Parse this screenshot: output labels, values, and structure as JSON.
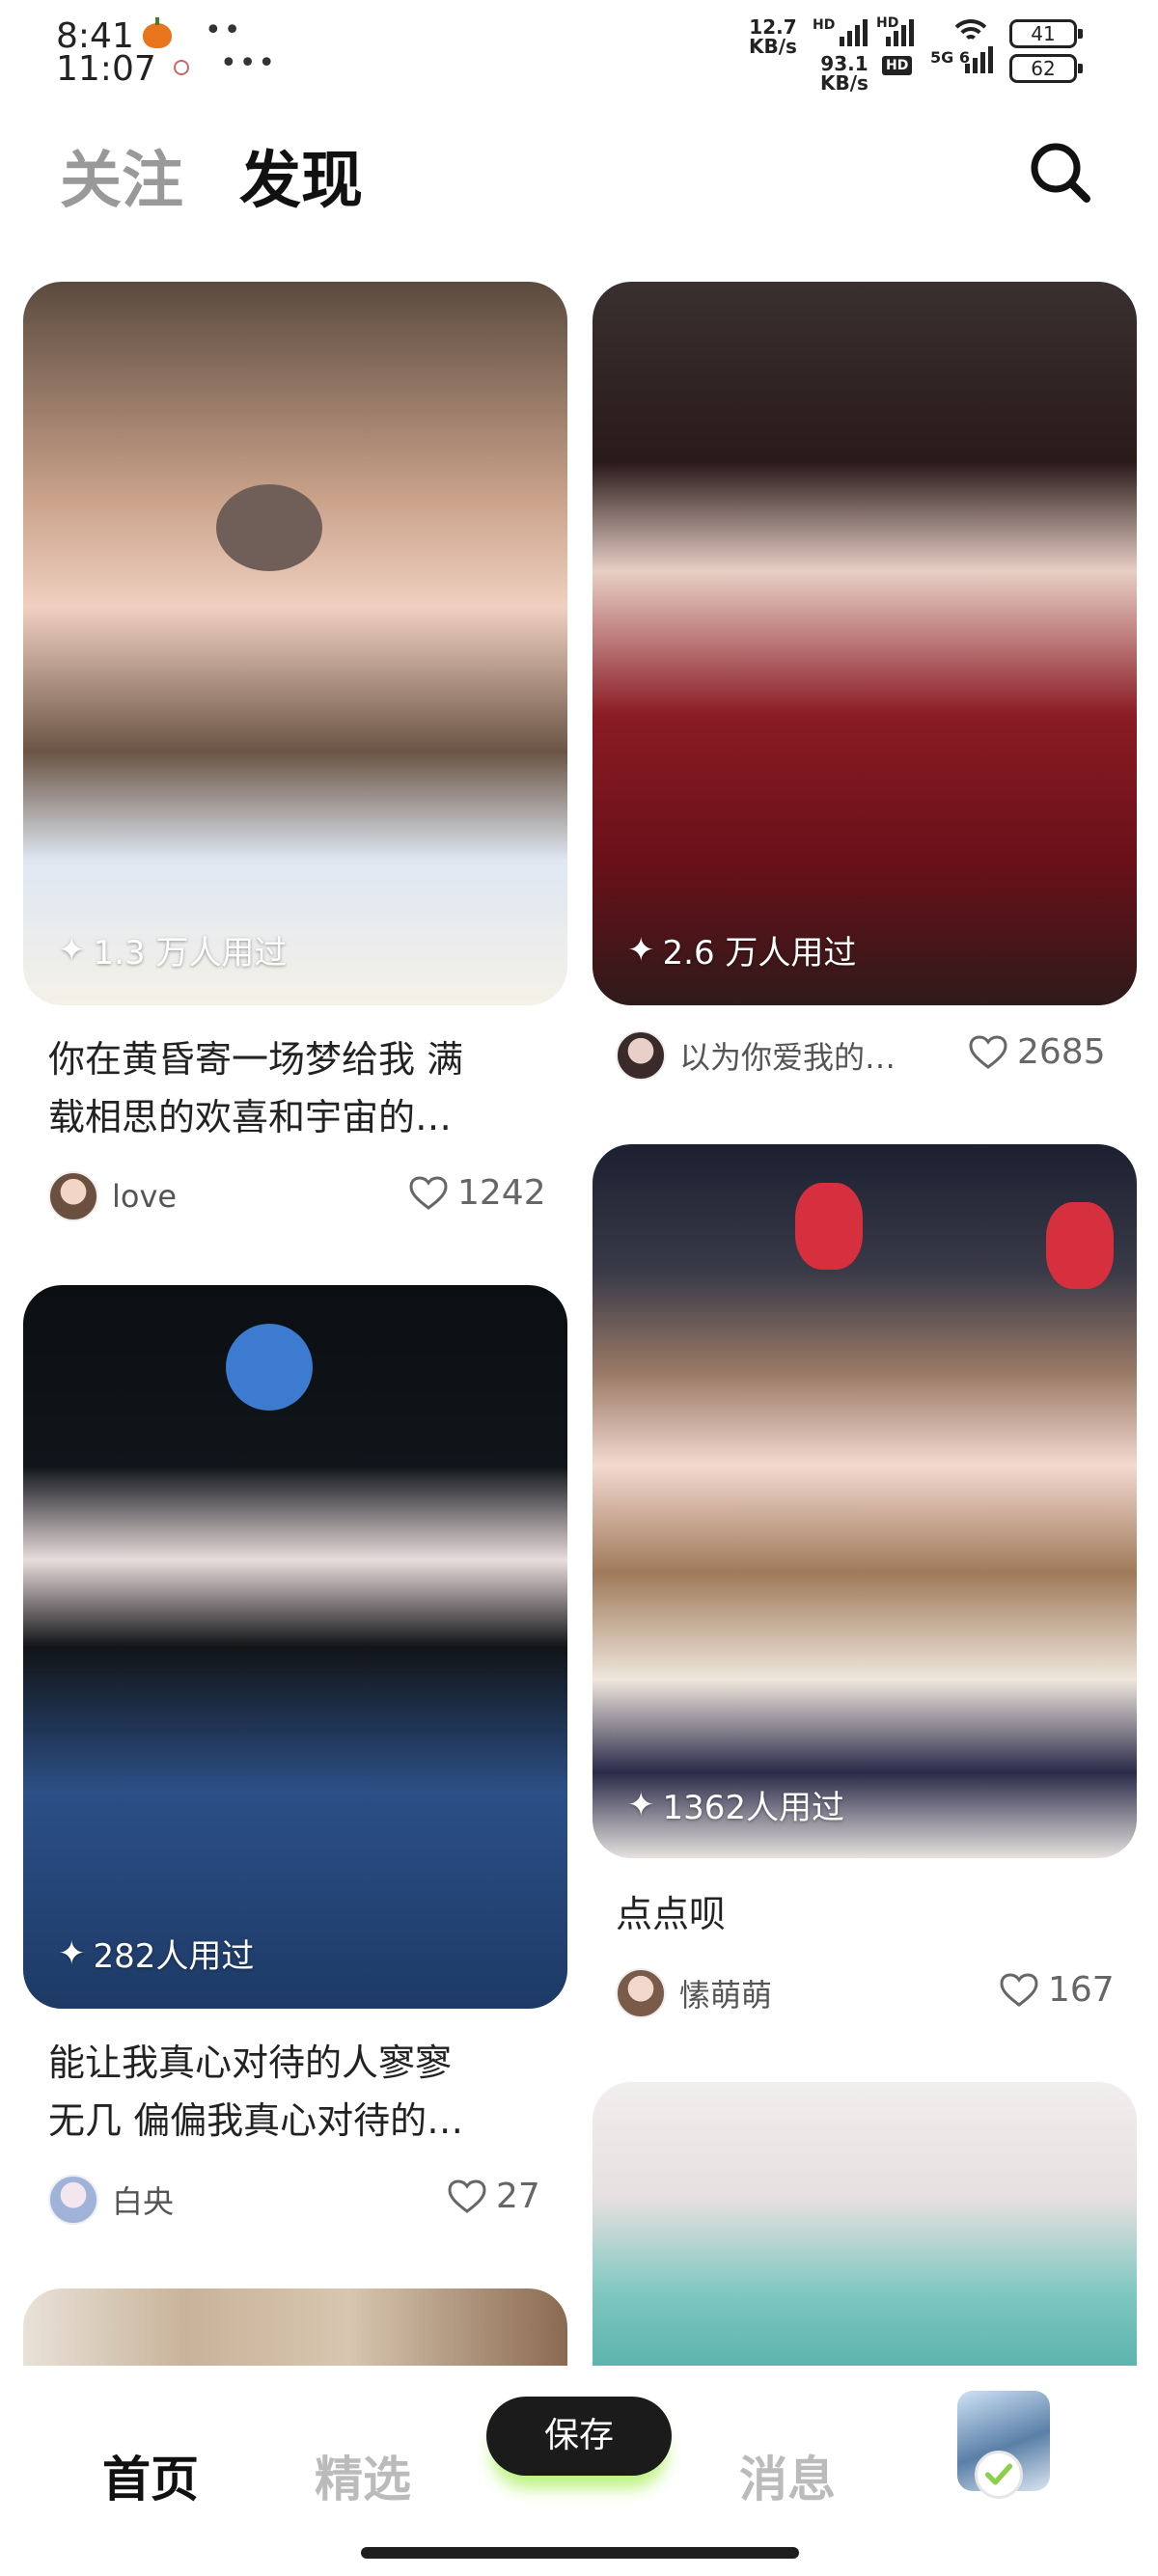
{
  "status_bar": {
    "time_primary": "8:41",
    "time_secondary": "11:07",
    "net_speed_1_value": "12.7",
    "net_speed_1_unit": "KB/s",
    "net_speed_2_value": "93.1",
    "net_speed_2_unit": "KB/s",
    "hd_label": "HD",
    "network_label": "5G",
    "network_sub": "6",
    "battery_1": "41",
    "battery_2": "62"
  },
  "header": {
    "tab_follow": "关注",
    "tab_discover": "发现",
    "active_tab": "发现"
  },
  "feed": {
    "cards": [
      {
        "used": "1.3 万人用过",
        "title_line1": "你在黄昏寄一场梦给我 满",
        "title_line2": "载相思的欢喜和宇宙的…",
        "author": "love",
        "likes": "1242"
      },
      {
        "used": "2.6 万人用过",
        "author": "以为你爱我的…",
        "likes": "2685"
      },
      {
        "used": "282人用过",
        "title_line1": "能让我真心对待的人寥寥",
        "title_line2": "无几 偏偏我真心对待的…",
        "author": "白央",
        "likes": "27"
      },
      {
        "used": "1362人用过",
        "title_line1": "点点呗",
        "author": "愫萌萌",
        "likes": "167"
      }
    ]
  },
  "bottom_nav": {
    "home": "首页",
    "featured": "精选",
    "save": "保存",
    "messages": "消息"
  },
  "colors": {
    "accent_green": "#b9f27a",
    "tab_highlight": "#d9f7a0",
    "active_text": "#111111",
    "inactive_text": "#bbbbbb"
  }
}
